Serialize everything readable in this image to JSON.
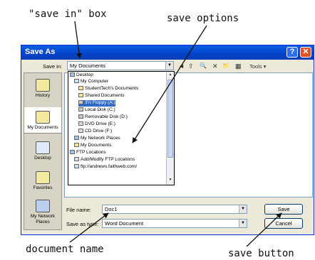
{
  "annotations": {
    "save_in_box": "\"save in\" box",
    "save_options": "save options",
    "document_name": "document name",
    "save_button": "save button"
  },
  "dialog": {
    "title": "Save As",
    "help_glyph": "?",
    "close_glyph": "✕"
  },
  "save_in": {
    "label": "Save in:",
    "value": "My Documents"
  },
  "toolbar": {
    "back": "◄",
    "up": "⇧",
    "search": "🔍",
    "delete": "✕",
    "new_folder": "📁",
    "views": "▦",
    "tools": "Tools ▾"
  },
  "places": [
    {
      "label": "History",
      "icon": "history-icon"
    },
    {
      "label": "My Documents",
      "icon": "my-documents-icon"
    },
    {
      "label": "Desktop",
      "icon": "desktop-icon"
    },
    {
      "label": "Favorites",
      "icon": "favorites-icon"
    },
    {
      "label": "My Network Places",
      "icon": "network-places-icon"
    }
  ],
  "save_options": [
    {
      "label": "Desktop",
      "indent": 0
    },
    {
      "label": "My Computer",
      "indent": 1
    },
    {
      "label": "StudentTech's Documents",
      "indent": 2
    },
    {
      "label": "Shared Documents",
      "indent": 2
    },
    {
      "label": "3½ Floppy (A:)",
      "indent": 2,
      "selected": true
    },
    {
      "label": "Local Disk (C:)",
      "indent": 2
    },
    {
      "label": "Removable Disk (D:)",
      "indent": 2
    },
    {
      "label": "DVD Drive (E:)",
      "indent": 2
    },
    {
      "label": "CD Drive (F:)",
      "indent": 2
    },
    {
      "label": "My Network Places",
      "indent": 1
    },
    {
      "label": "My Documents",
      "indent": 1
    },
    {
      "label": "FTP Locations",
      "indent": 0
    },
    {
      "label": "Add/Modify FTP Locations",
      "indent": 1
    },
    {
      "label": "ftp://andrews.faithweb.com/",
      "indent": 1
    }
  ],
  "file_name": {
    "label": "File name:",
    "value": "Doc1"
  },
  "save_as_type": {
    "label": "Save as type:",
    "value": "Word Document"
  },
  "buttons": {
    "save": "Save",
    "cancel": "Cancel"
  }
}
